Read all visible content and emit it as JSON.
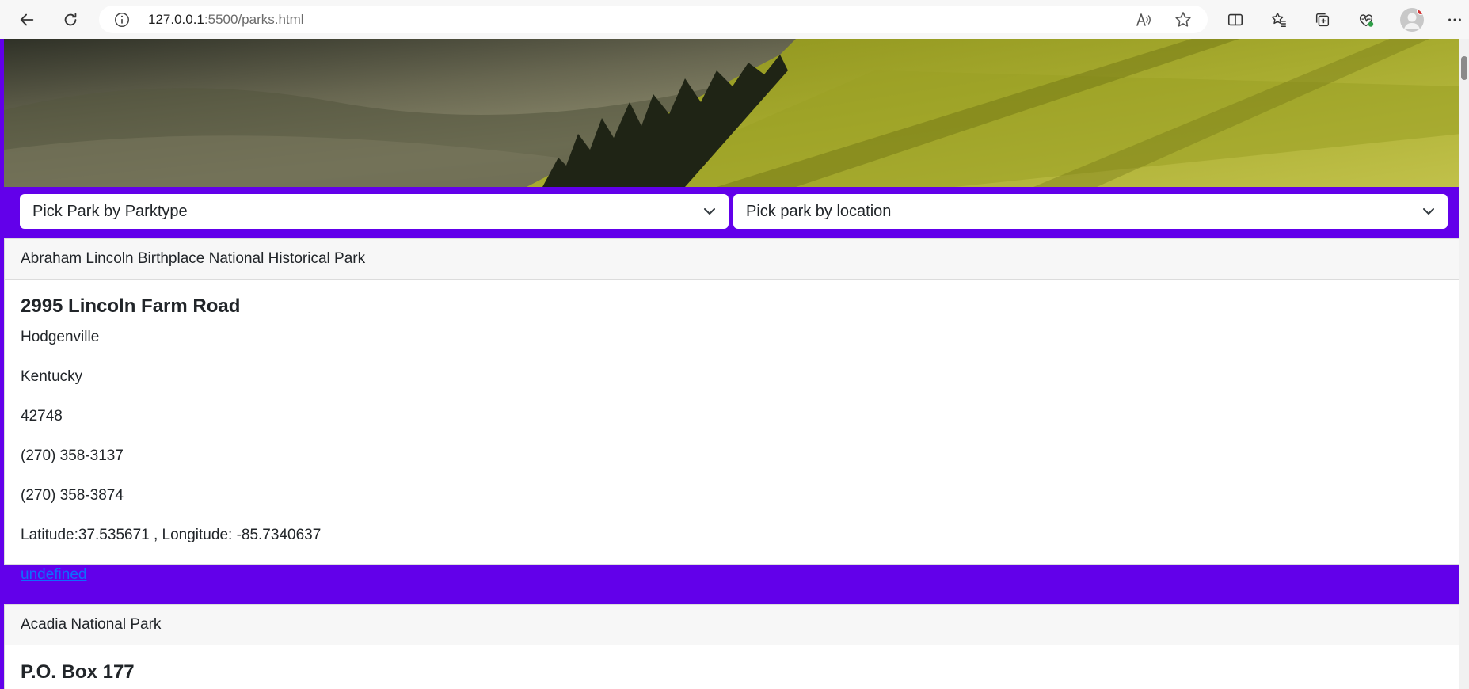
{
  "browser": {
    "url_host": "127.0.0.1",
    "url_path": ":5500/parks.html"
  },
  "filters": {
    "parktype_select": "Pick Park by Parktype",
    "location_select": "Pick park by location"
  },
  "parks": [
    {
      "name": "Abraham Lincoln Birthplace National Historical Park",
      "address": "2995 Lincoln Farm Road",
      "city": "Hodgenville",
      "state": "Kentucky",
      "zip": "42748",
      "phone": "(270) 358-3137",
      "fax": "(270) 358-3874",
      "coordinates": "Latitude:37.535671 , Longitude: -85.7340637",
      "link": "undefined"
    },
    {
      "name": "Acadia National Park",
      "address": "P.O. Box 177"
    }
  ],
  "colors": {
    "accent": "#6200ea",
    "link": "#0d6efd",
    "card_header_bg": "#f7f7f7"
  }
}
